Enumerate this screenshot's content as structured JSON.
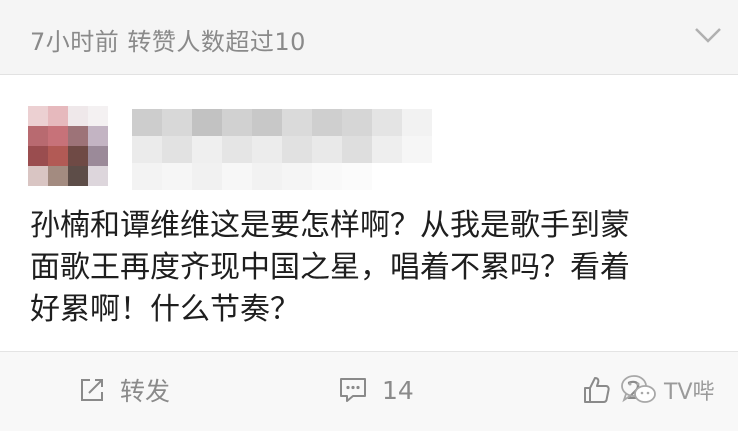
{
  "header": {
    "meta_text": "7小时前  转赞人数超过10",
    "expand_icon": "chevron-down-icon"
  },
  "post": {
    "avatar": "avatar-blurred",
    "username": "",
    "text": "孙楠和谭维维这是要怎样啊？从我是歌手到蒙\n面歌王再度齐现中国之星，唱着不累吗？看着\n好累啊！什么节奏？"
  },
  "actions": {
    "repost_icon": "edit-icon",
    "repost_label": "转发",
    "comment_icon": "comment-icon",
    "comment_count": "14",
    "like_icon": "thumbs-up-icon",
    "like_count": "2"
  },
  "watermark": {
    "icon": "wechat-icon",
    "text": "TV哔"
  },
  "colors": {
    "meta_text": "#8a8a8a",
    "body_text": "#1e1e1e",
    "top_bar_bg": "#f5f5f5",
    "action_bar_bg": "#f8f8f8"
  }
}
